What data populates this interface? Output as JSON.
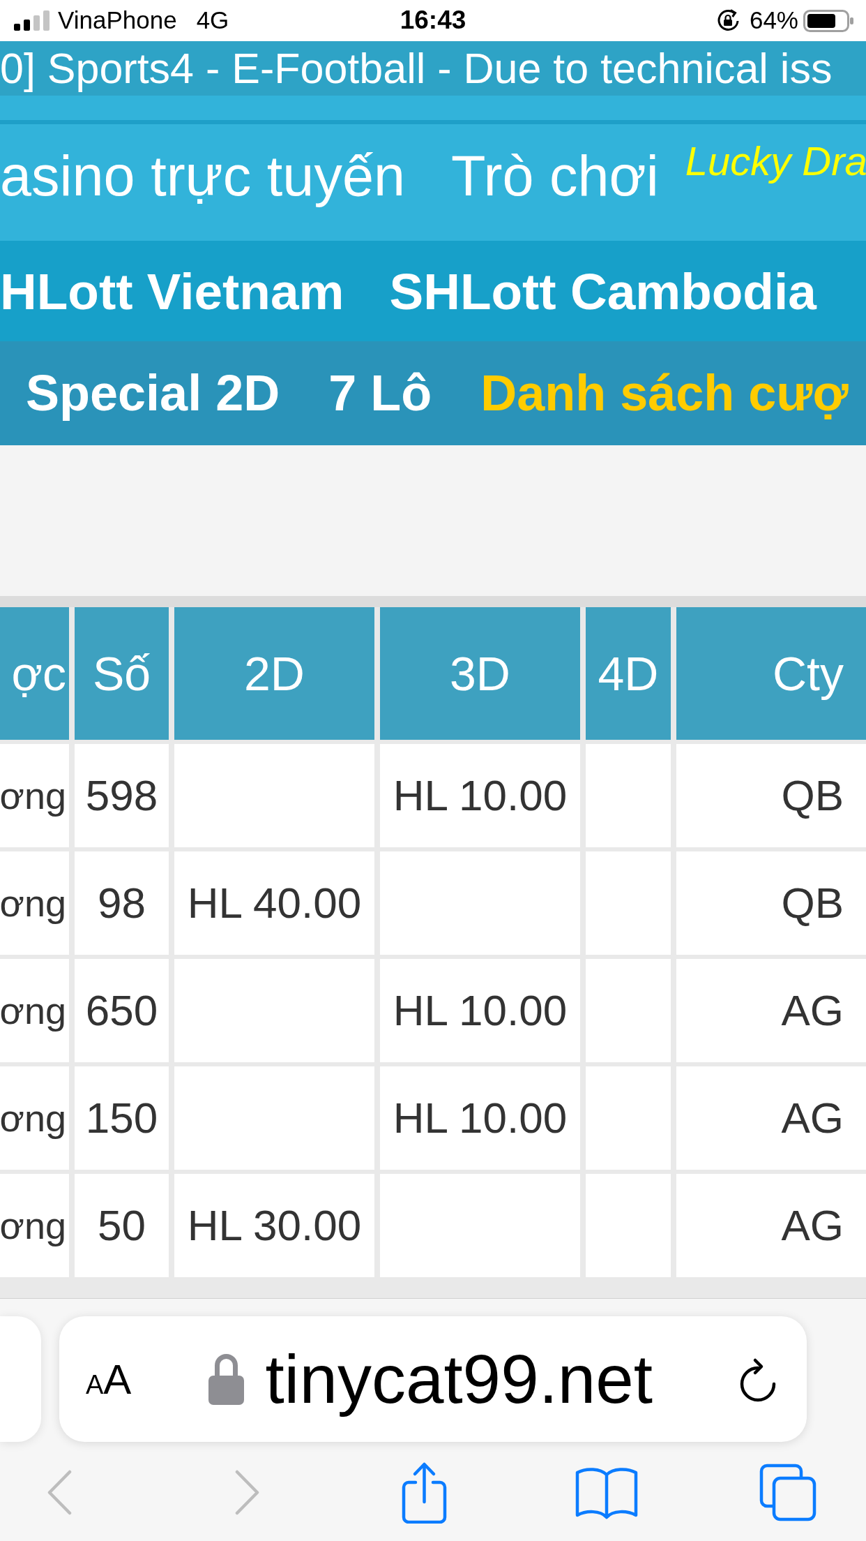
{
  "status_bar": {
    "carrier": "VinaPhone",
    "network": "4G",
    "time": "16:43",
    "battery": "64%"
  },
  "ticker": {
    "text": "0] Sports4 - E-Football - Due to technical iss"
  },
  "menu_row_1": [
    {
      "label": "asino trực tuyến",
      "kind": "link"
    },
    {
      "label": "Trò chơi",
      "kind": "link"
    },
    {
      "label": "Lucky Dra",
      "kind": "promo"
    }
  ],
  "menu_row_2": [
    "HLott Vietnam",
    "SHLott Cambodia"
  ],
  "menu_row_3": [
    {
      "label": "Special 2D",
      "selected": false
    },
    {
      "label": "7 Lô",
      "selected": false
    },
    {
      "label": "Danh sách cượ",
      "selected": true
    }
  ],
  "table": {
    "columns": [
      "ợc",
      "Số",
      "2D",
      "3D",
      "4D",
      "Cty"
    ],
    "rows": [
      {
        "column_1": "ơng",
        "number": "598",
        "amount_3d": "HL 10.00",
        "company": "QB"
      },
      {
        "column_1": "ơng",
        "number": "98",
        "amount_2d": "HL 40.00",
        "company": "QB"
      },
      {
        "column_1": "ơng",
        "number": "650",
        "amount_3d": "HL 10.00",
        "company": "AG"
      },
      {
        "column_1": "ơng",
        "number": "150",
        "amount_3d": "HL 10.00",
        "company": "AG"
      },
      {
        "column_1": "ơng",
        "number": "50",
        "amount_2d": "HL 30.00",
        "company": "AG"
      }
    ]
  },
  "browser": {
    "text_size_button": {
      "small": "A",
      "large": "A"
    },
    "url": "tinycat99.net",
    "toolbar": [
      {
        "kind": "back",
        "disabled": true
      },
      {
        "kind": "forward",
        "disabled": true
      },
      {
        "kind": "share",
        "disabled": false
      },
      {
        "kind": "bookmarks",
        "disabled": false
      },
      {
        "kind": "tabs",
        "disabled": false
      }
    ]
  }
}
